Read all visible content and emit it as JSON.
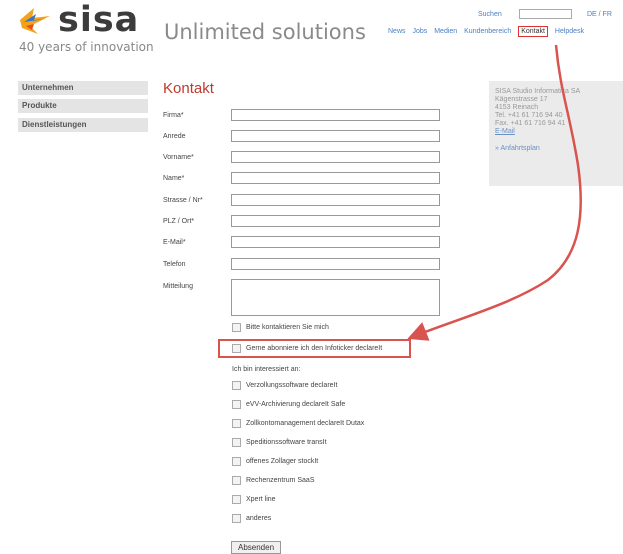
{
  "header": {
    "logo_text": "sisa",
    "tagline": "Unlimited solutions",
    "since": "40 years of innovation",
    "search_label": "Suchen",
    "search_value": "",
    "lang": "DE / FR",
    "nav": [
      "News",
      "Jobs",
      "Medien",
      "Kundenbereich",
      "Kontakt",
      "Helpdesk"
    ]
  },
  "sidebar": {
    "items": [
      "Unternehmen",
      "Produkte",
      "Dienstleistungen"
    ]
  },
  "infobox": {
    "lines": [
      "SISA Studio Informatica SA",
      "Kägenstrasse 17",
      "4153 Reinach",
      "Tel. +41 61 716 94 40",
      "Fax. +41 61 716 94 41"
    ],
    "email": "E-Mail",
    "route": "» Anfahrtsplan"
  },
  "form": {
    "title": "Kontakt",
    "fields": [
      "Firma*",
      "Anrede",
      "Vorname*",
      "Name*",
      "Strasse / Nr*",
      "PLZ / Ort*",
      "E-Mail*",
      "Telefon"
    ],
    "message_label": "Mitteilung",
    "contact_me": "Bitte kontaktieren Sie mich",
    "newsletter": "Gerne abonniere ich den Infoticker declareIt",
    "interest_label": "Ich bin interessiert an:",
    "interests": [
      "Verzollungssoftware declareIt",
      "eVV-Archivierung declareIt Safe",
      "Zollkontomanagement declareIt Dutax",
      "Speditionssoftware transIt",
      "offenes Zollager stockIt",
      "Rechenzentrum SaaS",
      "Xpert line",
      "anderes"
    ],
    "submit": "Absenden"
  },
  "colors": {
    "accent": "#c0392b",
    "link": "#4a7fc1",
    "annotation": "#d9534f"
  }
}
